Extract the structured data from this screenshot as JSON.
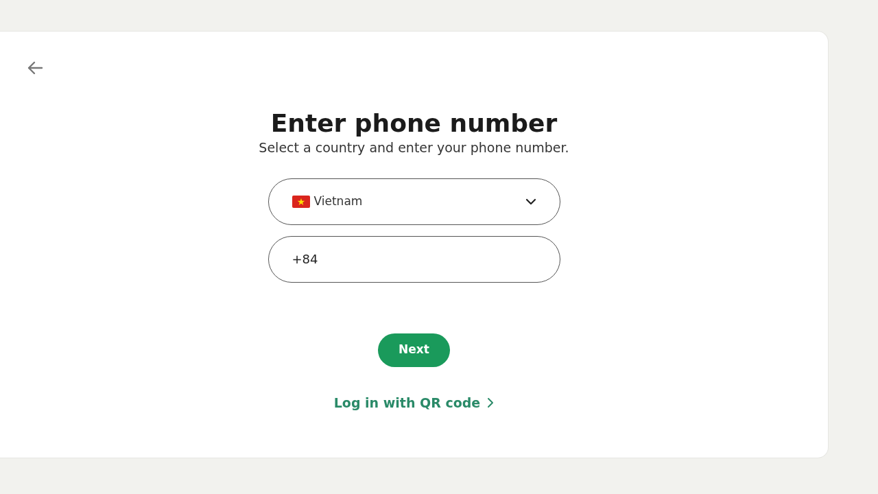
{
  "title": "Enter phone number",
  "subtitle": "Select a country and enter your phone number.",
  "country": {
    "value": "Vietnam"
  },
  "phone": {
    "value": "+84"
  },
  "next_button": "Next",
  "qr_link": "Log in with QR code"
}
